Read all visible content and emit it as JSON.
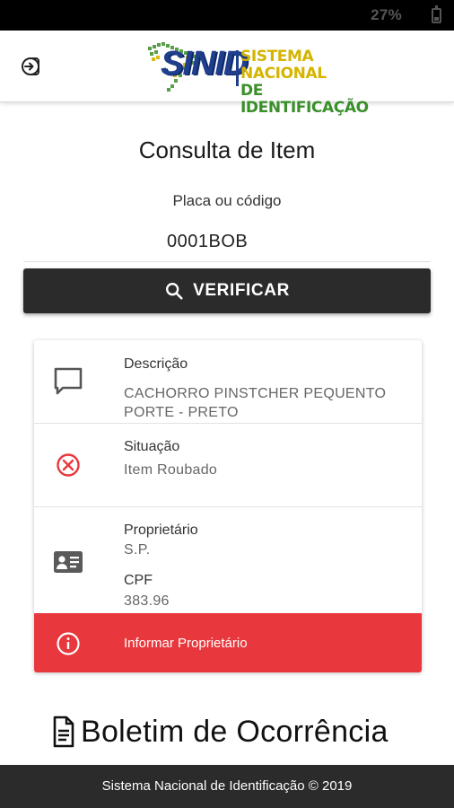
{
  "status_bar": {
    "battery": "27%"
  },
  "header": {
    "logo_letters": "SINID",
    "logo_line1": "SISTEMA NACIONAL",
    "logo_line2": "DE IDENTIFICAÇÃO"
  },
  "page": {
    "title": "Consulta de Item",
    "field_label": "Placa ou código",
    "field_value": "0001BOB",
    "verify_button": "VERIFICAR"
  },
  "result": {
    "description_title": "Descrição",
    "description_value": "CACHORRO PINSTCHER PEQUENTO PORTE - PRETO",
    "status_title": "Situação",
    "status_value": "Item Roubado",
    "owner_title": "Proprietário",
    "owner_value": "S.P.",
    "cpf_title": "CPF",
    "cpf_value": "383.96",
    "alert_label": "Informar Proprietário"
  },
  "section": {
    "title": "Boletim de Ocorrência"
  },
  "footer": {
    "text": "Sistema Nacional de Identificação © 2019"
  },
  "colors": {
    "danger": "#e8383d",
    "dark": "#2b2b2b",
    "brand_blue": "#1f3e8c",
    "brand_green": "#3a8f2a",
    "brand_yellow": "#d5b400"
  },
  "icons": {
    "logout": "logout-icon",
    "search": "search-icon",
    "description": "chat-bubble-icon",
    "status": "cancel-circle-icon",
    "owner": "id-card-icon",
    "alert": "info-icon",
    "document": "document-icon"
  }
}
